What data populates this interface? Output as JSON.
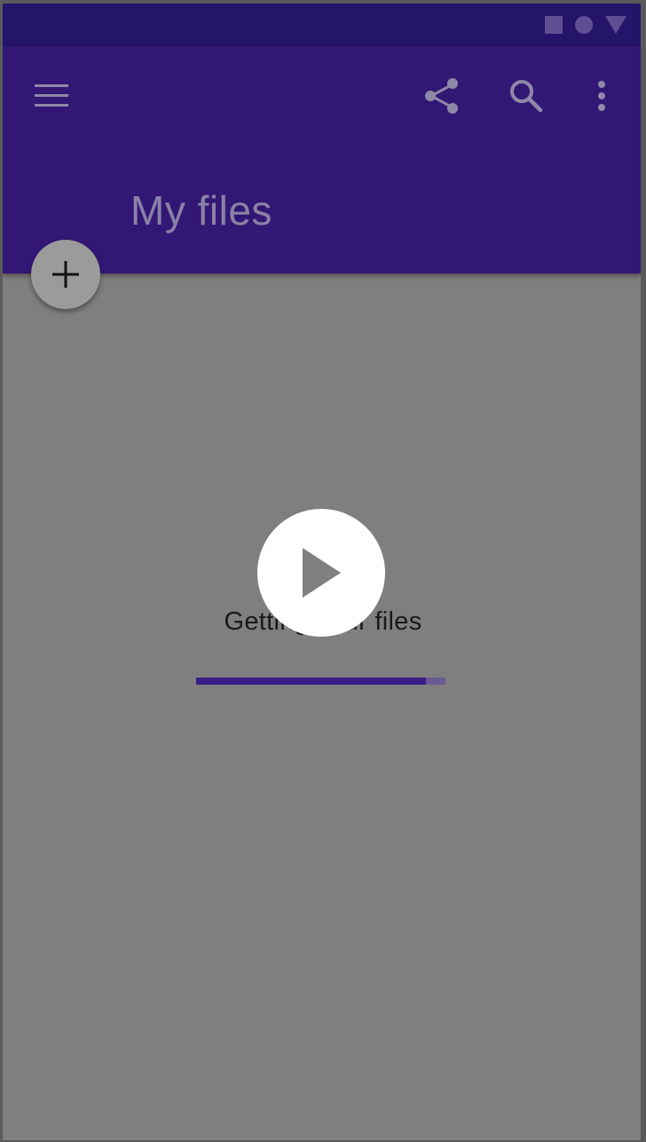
{
  "status_bar": {
    "icons": [
      "square-icon",
      "circle-icon",
      "triangle-icon"
    ]
  },
  "app_bar": {
    "title": "My files",
    "icons": {
      "menu": "menu-icon",
      "share": "share-icon",
      "search": "search-icon",
      "more": "more-vert-icon"
    }
  },
  "fab": {
    "icon": "plus-icon"
  },
  "loading": {
    "text": "Getting your files",
    "progress": 0.92
  },
  "overlay": {
    "icon": "play-icon"
  },
  "colors": {
    "app_bar": "#331775",
    "status_bar": "#24146a",
    "background": "#7f7f7f",
    "progress_fill": "#3a1c86",
    "progress_track": "#6a5a92",
    "icon_tint": "#8f88a8"
  }
}
